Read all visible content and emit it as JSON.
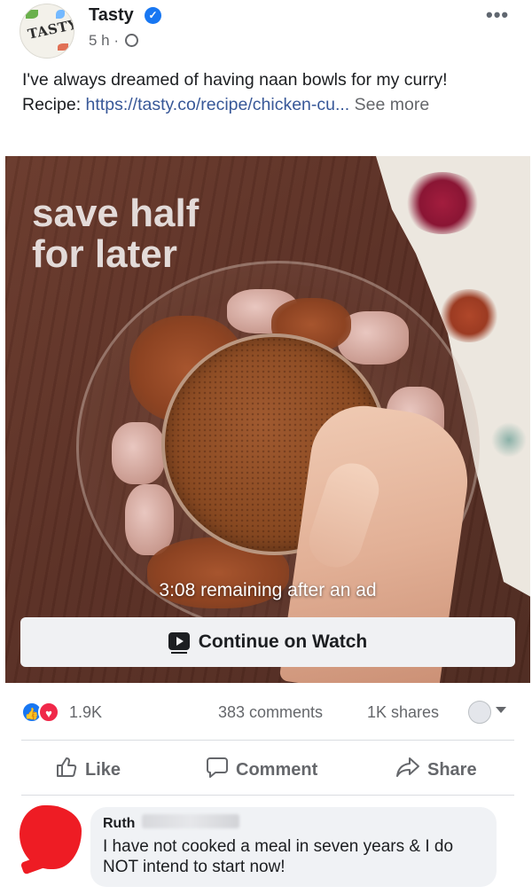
{
  "post": {
    "page_name": "Tasty",
    "avatar_text": "TASTY",
    "time": "5 h ·",
    "caption_line1": "I've always dreamed of having naan bowls for my curry!",
    "recipe_label": "Recipe: ",
    "recipe_link": "https://tasty.co/recipe/chicken-cu...",
    "see_more": " See more"
  },
  "video": {
    "overlay_title_line1": "save half",
    "overlay_title_line2": "for later",
    "remaining_text": "3:08 remaining after an ad",
    "continue_label": "Continue on Watch"
  },
  "stats": {
    "reactions_count": "1.9K",
    "comments": "383 comments",
    "shares": "1K shares"
  },
  "actions": {
    "like": "Like",
    "comment": "Comment",
    "share": "Share"
  },
  "comment": {
    "name": "Ruth",
    "text": "I have not cooked a meal in seven years & I do NOT intend to start now!"
  },
  "colors": {
    "facebook_blue": "#1877f2",
    "love_red": "#f02849",
    "link": "#385898",
    "secondary_text": "#65676b"
  },
  "icons": [
    "verified-badge-icon",
    "globe-icon",
    "more-options-icon",
    "watch-play-icon",
    "like-reaction-icon",
    "love-reaction-icon",
    "caret-down-icon",
    "thumbs-up-icon",
    "comment-bubble-icon",
    "share-arrow-icon"
  ]
}
